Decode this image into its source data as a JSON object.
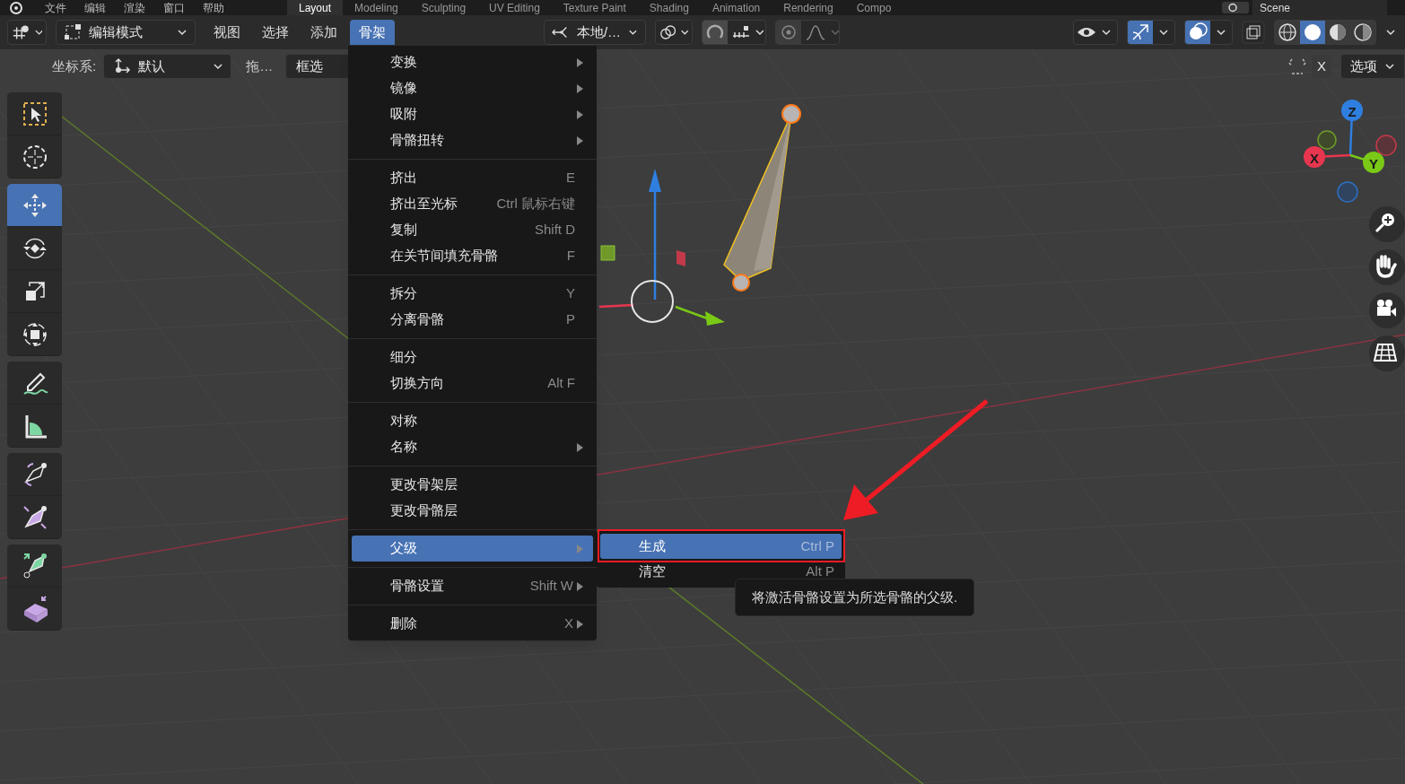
{
  "top_menu": [
    "文件",
    "编辑",
    "渲染",
    "窗口",
    "帮助"
  ],
  "workspace_tabs": [
    {
      "label": "Layout",
      "selected": true
    },
    {
      "label": "Modeling",
      "selected": false
    },
    {
      "label": "Sculpting",
      "selected": false
    },
    {
      "label": "UV Editing",
      "selected": false
    },
    {
      "label": "Texture Paint",
      "selected": false
    },
    {
      "label": "Shading",
      "selected": false
    },
    {
      "label": "Animation",
      "selected": false
    },
    {
      "label": "Rendering",
      "selected": false
    },
    {
      "label": "Compo",
      "selected": false
    }
  ],
  "scene": "Scene",
  "header": {
    "mode": "编辑模式",
    "menus": [
      {
        "label": "视图",
        "selected": false
      },
      {
        "label": "选择",
        "selected": false
      },
      {
        "label": "添加",
        "selected": false
      },
      {
        "label": "骨架",
        "selected": true
      }
    ],
    "orientation": "本地/…",
    "shading_modes": [
      {
        "kind": "wireframe",
        "selected": false
      },
      {
        "kind": "solid",
        "selected": true
      },
      {
        "kind": "material",
        "selected": false
      },
      {
        "kind": "rendered",
        "selected": false
      }
    ]
  },
  "tool_settings": {
    "coord_label": "坐标系:",
    "coord_value": "默认",
    "drag_label": "拖…",
    "drag_value": "框选",
    "axis_button": "X",
    "options": "选项"
  },
  "tool_groups": [
    {
      "tools": [
        {
          "kind": "select_box",
          "selected": false
        },
        {
          "kind": "cursor",
          "selected": false
        }
      ]
    },
    {
      "tools": [
        {
          "kind": "move",
          "selected": true
        },
        {
          "kind": "rotate",
          "selected": false
        },
        {
          "kind": "scale",
          "selected": false
        },
        {
          "kind": "transform",
          "selected": false
        }
      ]
    },
    {
      "tools": [
        {
          "kind": "annotate",
          "selected": false
        },
        {
          "kind": "measure",
          "selected": false
        }
      ]
    },
    {
      "tools": [
        {
          "kind": "roll",
          "selected": false
        },
        {
          "kind": "bone_size",
          "selected": false
        }
      ]
    },
    {
      "tools": [
        {
          "kind": "extrude",
          "selected": false
        },
        {
          "kind": "extrude_region",
          "selected": false
        }
      ]
    }
  ],
  "menu": [
    {
      "items": [
        {
          "label": "变换",
          "submenu": true,
          "selected": false
        },
        {
          "label": "镜像",
          "submenu": true,
          "selected": false
        },
        {
          "label": "吸附",
          "submenu": true,
          "selected": false
        },
        {
          "label": "骨骼扭转",
          "submenu": true,
          "selected": false
        }
      ]
    },
    {
      "items": [
        {
          "label": "挤出",
          "shortcut": "E",
          "selected": false
        },
        {
          "label": "挤出至光标",
          "shortcut": "Ctrl 鼠标右键",
          "selected": false
        },
        {
          "label": "复制",
          "shortcut": "Shift D",
          "selected": false
        },
        {
          "label": "在关节间填充骨骼",
          "shortcut": "F",
          "selected": false
        }
      ]
    },
    {
      "items": [
        {
          "label": "拆分",
          "shortcut": "Y",
          "selected": false
        },
        {
          "label": "分离骨骼",
          "shortcut": "P",
          "selected": false
        }
      ]
    },
    {
      "items": [
        {
          "label": "细分",
          "selected": false
        },
        {
          "label": "切换方向",
          "shortcut": "Alt F",
          "selected": false
        }
      ]
    },
    {
      "items": [
        {
          "label": "对称",
          "selected": false
        },
        {
          "label": "名称",
          "submenu": true,
          "selected": false
        }
      ]
    },
    {
      "items": [
        {
          "label": "更改骨架层",
          "selected": false
        },
        {
          "label": "更改骨骼层",
          "selected": false
        }
      ]
    },
    {
      "items": [
        {
          "label": "父级",
          "submenu": true,
          "selected": true
        }
      ]
    },
    {
      "items": [
        {
          "label": "骨骼设置",
          "shortcut": "Shift W",
          "submenu": true,
          "selected": false
        }
      ]
    },
    {
      "items": [
        {
          "label": "删除",
          "shortcut": "X",
          "submenu": true,
          "selected": false
        }
      ]
    }
  ],
  "submenu": [
    {
      "label": "生成",
      "shortcut": "Ctrl P",
      "selected": true
    },
    {
      "label": "清空",
      "shortcut": "Alt P",
      "selected": false
    }
  ],
  "tooltip": "将激活骨骼设置为所选骨骼的父级.",
  "axes": [
    {
      "label": "Z",
      "color": "#2f7fe0"
    },
    {
      "label": "X",
      "color": "#e8364f"
    },
    {
      "label": "Y",
      "color": "#7ac916"
    }
  ]
}
